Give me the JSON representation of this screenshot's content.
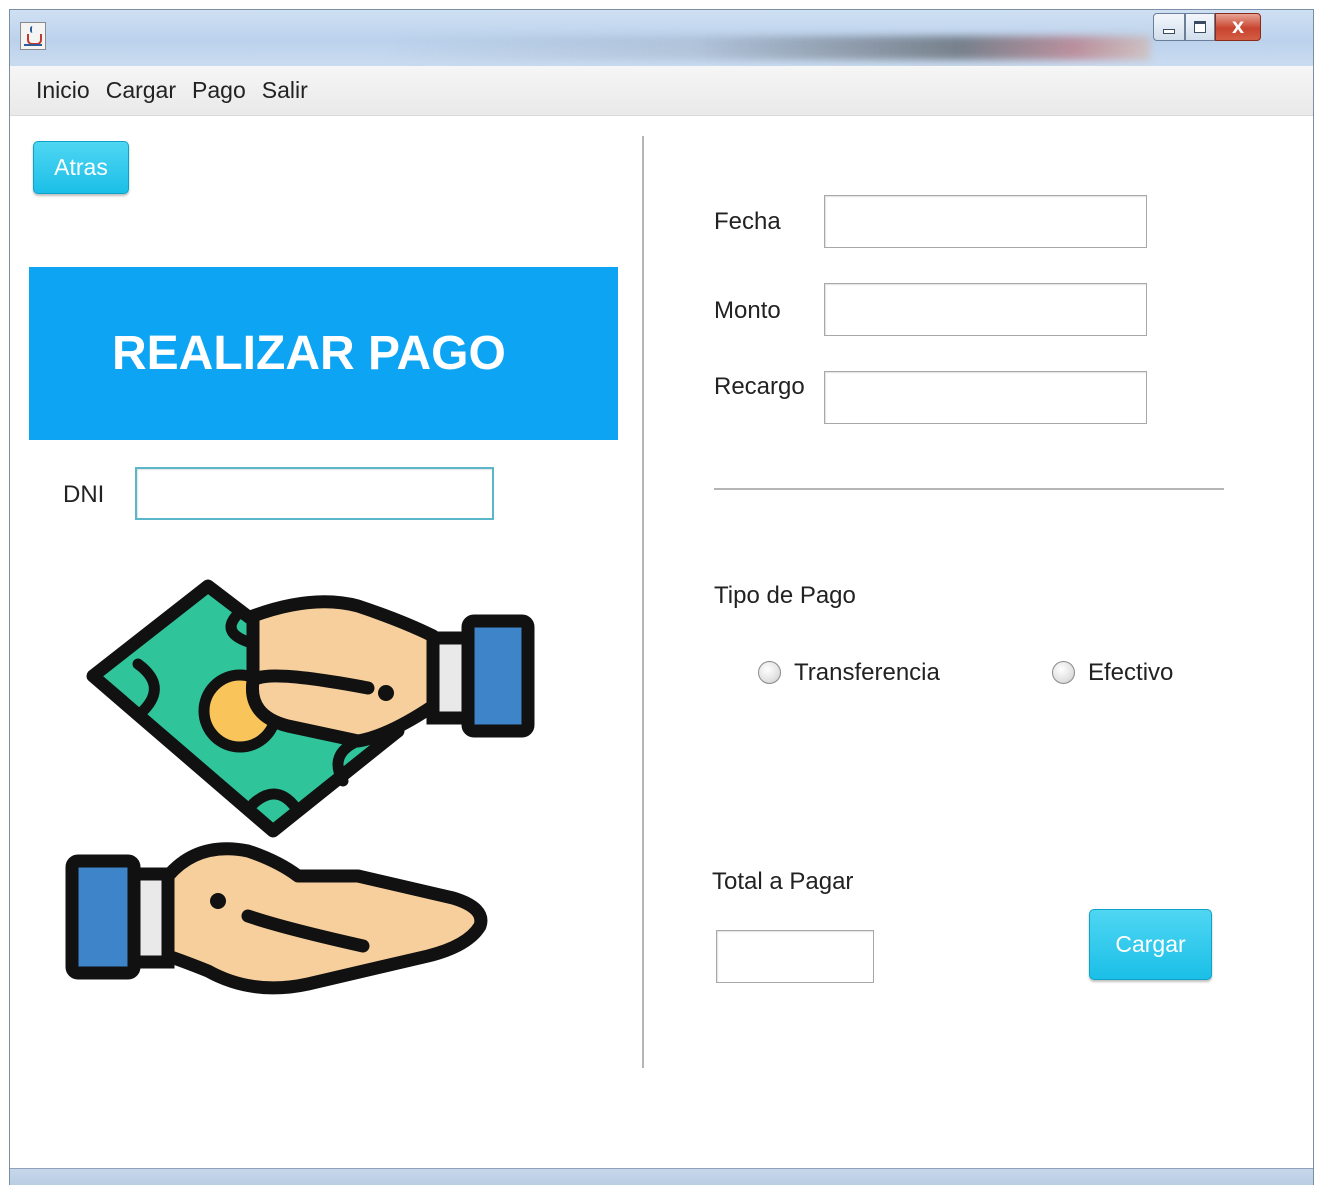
{
  "window": {
    "controls": {
      "minimize_icon": "minimize-icon",
      "maximize_icon": "maximize-icon",
      "close_label": "X"
    }
  },
  "menu": {
    "items": [
      "Inicio",
      "Cargar",
      "Pago",
      "Salir"
    ]
  },
  "left_panel": {
    "back_button": "Atras",
    "banner_title": "REALIZAR PAGO",
    "dni_label": "DNI",
    "dni_value": "",
    "illustration_icon": "hand-giving-money-icon"
  },
  "right_panel": {
    "fields": [
      {
        "label": "Fecha",
        "value": ""
      },
      {
        "label": "Monto",
        "value": ""
      },
      {
        "label": "Recargo",
        "value": ""
      }
    ],
    "payment_type": {
      "label": "Tipo de Pago",
      "options": [
        {
          "label": "Transferencia",
          "selected": false
        },
        {
          "label": "Efectivo",
          "selected": false
        }
      ]
    },
    "total": {
      "label": "Total a Pagar",
      "value": ""
    },
    "submit_button": "Cargar"
  },
  "colors": {
    "button": "#1bbfe7",
    "banner": "#0ea4f4",
    "banner_text": "#ffffff"
  }
}
